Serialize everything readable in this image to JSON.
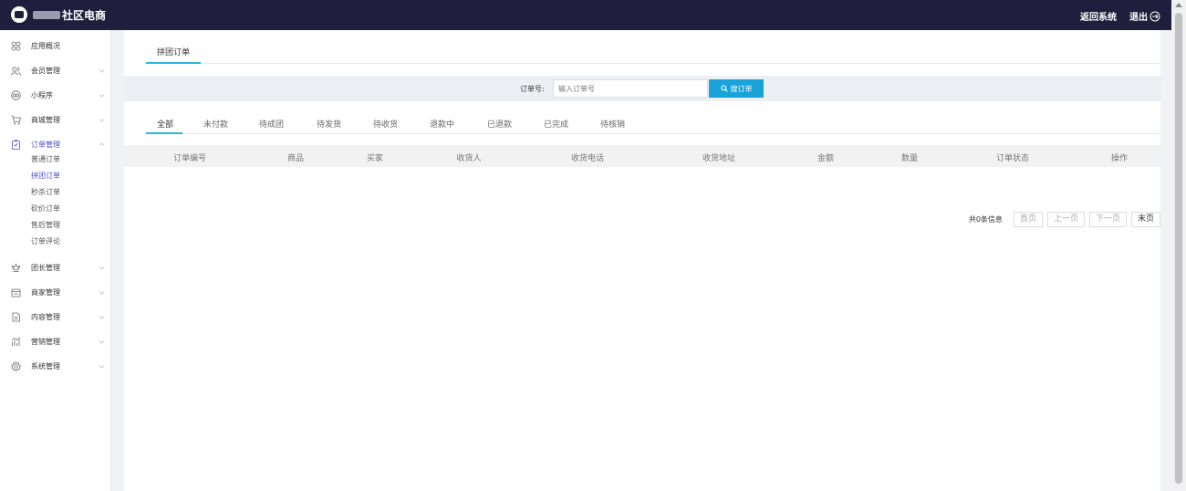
{
  "app": {
    "title": "社区电商"
  },
  "topbar": {
    "back_label": "返回系统",
    "logout_label": "退出"
  },
  "sidebar": {
    "items": [
      {
        "label": "应用概况",
        "icon": "grid-icon"
      },
      {
        "label": "会员管理",
        "icon": "users-icon"
      },
      {
        "label": "小程序",
        "icon": "miniapp-icon"
      },
      {
        "label": "商城管理",
        "icon": "cart-icon"
      },
      {
        "label": "订单管理",
        "icon": "order-icon",
        "expanded": true
      },
      {
        "label": "团长管理",
        "icon": "crown-icon"
      },
      {
        "label": "商家管理",
        "icon": "store-icon"
      },
      {
        "label": "内容管理",
        "icon": "document-icon"
      },
      {
        "label": "营销管理",
        "icon": "chart-icon"
      },
      {
        "label": "系统管理",
        "icon": "settings-icon"
      }
    ],
    "order_sub": [
      "普通订单",
      "拼团订单",
      "秒杀订单",
      "砍价订单",
      "售后管理",
      "订单评论"
    ],
    "active_sub": "拼团订单"
  },
  "page": {
    "tab": "拼团订单"
  },
  "search": {
    "label": "订单号:",
    "placeholder": "输入订单号",
    "button": "搜订单"
  },
  "status_tabs": [
    "全部",
    "未付款",
    "待成团",
    "待发货",
    "待收货",
    "退款中",
    "已退款",
    "已完成",
    "待核销"
  ],
  "table": {
    "headers": [
      "订单编号",
      "商品",
      "买家",
      "收货人",
      "收货电话",
      "收货地址",
      "金额",
      "数量",
      "订单状态",
      "操作"
    ]
  },
  "pager": {
    "info": "共0条信息",
    "first": "首页",
    "prev": "上一页",
    "next": "下一页",
    "last": "末页"
  },
  "colors": {
    "topbar": "#1f1f3d",
    "accent": "#2ab7d9",
    "active_nav": "#4d4dc6",
    "search_button": "#1aa3d8"
  }
}
